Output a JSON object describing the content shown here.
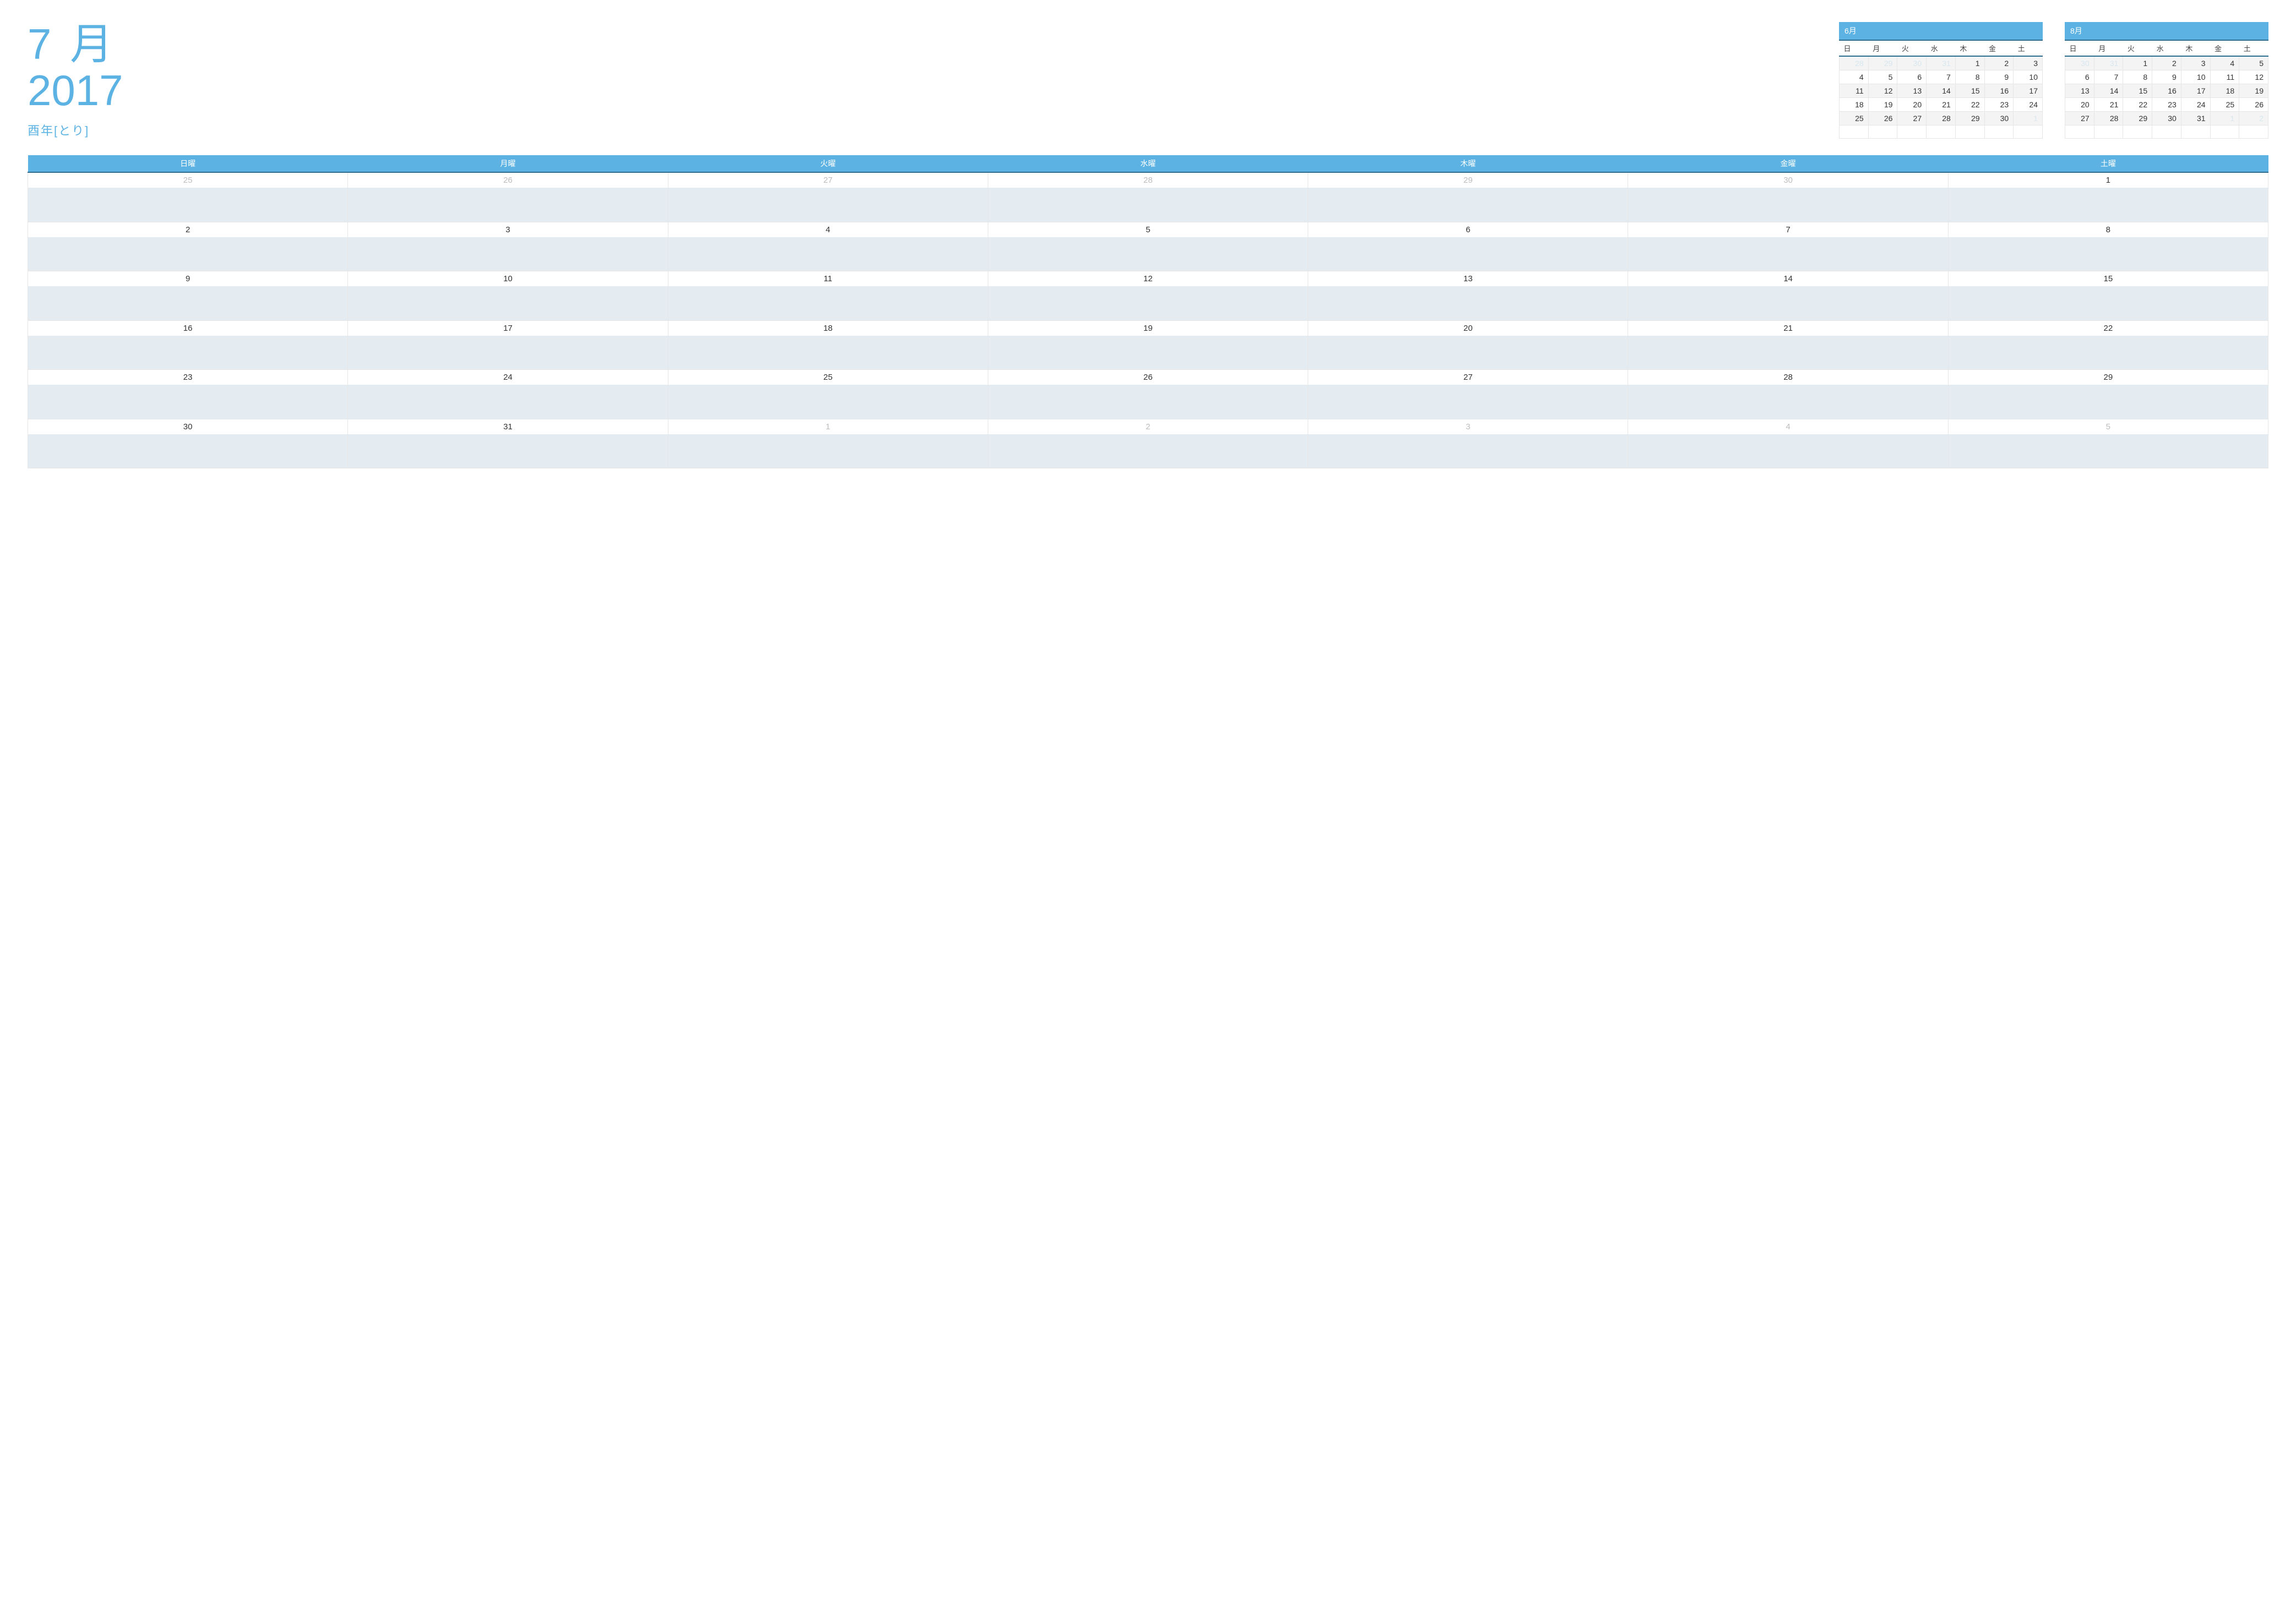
{
  "colors": {
    "accent": "#5cb3e3",
    "accent_dark": "#2f6d8f",
    "body_bg": "#e4ecf1"
  },
  "title": {
    "month": "7 月",
    "year": "2017",
    "sub": "酉年[とり]"
  },
  "mini_prev": {
    "label": "6月",
    "dow": [
      "日",
      "月",
      "火",
      "水",
      "木",
      "金",
      "土"
    ],
    "rows": [
      [
        {
          "v": "28",
          "dim": true
        },
        {
          "v": "29",
          "dim": true
        },
        {
          "v": "30",
          "dim": true
        },
        {
          "v": "31",
          "dim": true
        },
        {
          "v": "1"
        },
        {
          "v": "2"
        },
        {
          "v": "3"
        }
      ],
      [
        {
          "v": "4"
        },
        {
          "v": "5"
        },
        {
          "v": "6"
        },
        {
          "v": "7"
        },
        {
          "v": "8"
        },
        {
          "v": "9"
        },
        {
          "v": "10"
        }
      ],
      [
        {
          "v": "11"
        },
        {
          "v": "12"
        },
        {
          "v": "13"
        },
        {
          "v": "14"
        },
        {
          "v": "15"
        },
        {
          "v": "16"
        },
        {
          "v": "17"
        }
      ],
      [
        {
          "v": "18"
        },
        {
          "v": "19"
        },
        {
          "v": "20"
        },
        {
          "v": "21"
        },
        {
          "v": "22"
        },
        {
          "v": "23"
        },
        {
          "v": "24"
        }
      ],
      [
        {
          "v": "25"
        },
        {
          "v": "26"
        },
        {
          "v": "27"
        },
        {
          "v": "28"
        },
        {
          "v": "29"
        },
        {
          "v": "30"
        },
        {
          "v": "1",
          "dim": true
        }
      ],
      [
        {
          "v": ""
        },
        {
          "v": ""
        },
        {
          "v": ""
        },
        {
          "v": ""
        },
        {
          "v": ""
        },
        {
          "v": ""
        },
        {
          "v": ""
        }
      ]
    ]
  },
  "mini_next": {
    "label": "8月",
    "dow": [
      "日",
      "月",
      "火",
      "水",
      "木",
      "金",
      "土"
    ],
    "rows": [
      [
        {
          "v": "30",
          "dim": true
        },
        {
          "v": "31",
          "dim": true
        },
        {
          "v": "1"
        },
        {
          "v": "2"
        },
        {
          "v": "3"
        },
        {
          "v": "4"
        },
        {
          "v": "5"
        }
      ],
      [
        {
          "v": "6"
        },
        {
          "v": "7"
        },
        {
          "v": "8"
        },
        {
          "v": "9"
        },
        {
          "v": "10"
        },
        {
          "v": "11"
        },
        {
          "v": "12"
        }
      ],
      [
        {
          "v": "13"
        },
        {
          "v": "14"
        },
        {
          "v": "15"
        },
        {
          "v": "16"
        },
        {
          "v": "17"
        },
        {
          "v": "18"
        },
        {
          "v": "19"
        }
      ],
      [
        {
          "v": "20"
        },
        {
          "v": "21"
        },
        {
          "v": "22"
        },
        {
          "v": "23"
        },
        {
          "v": "24"
        },
        {
          "v": "25"
        },
        {
          "v": "26"
        }
      ],
      [
        {
          "v": "27"
        },
        {
          "v": "28"
        },
        {
          "v": "29"
        },
        {
          "v": "30"
        },
        {
          "v": "31"
        },
        {
          "v": "1",
          "dim": true
        },
        {
          "v": "2",
          "dim": true
        }
      ],
      [
        {
          "v": ""
        },
        {
          "v": ""
        },
        {
          "v": ""
        },
        {
          "v": ""
        },
        {
          "v": ""
        },
        {
          "v": ""
        },
        {
          "v": ""
        }
      ]
    ]
  },
  "big": {
    "dow": [
      "日曜",
      "月曜",
      "火曜",
      "水曜",
      "木曜",
      "金曜",
      "土曜"
    ],
    "weeks": [
      [
        {
          "v": "25",
          "dim": true
        },
        {
          "v": "26",
          "dim": true
        },
        {
          "v": "27",
          "dim": true
        },
        {
          "v": "28",
          "dim": true
        },
        {
          "v": "29",
          "dim": true
        },
        {
          "v": "30",
          "dim": true
        },
        {
          "v": "1"
        }
      ],
      [
        {
          "v": "2"
        },
        {
          "v": "3"
        },
        {
          "v": "4"
        },
        {
          "v": "5"
        },
        {
          "v": "6"
        },
        {
          "v": "7"
        },
        {
          "v": "8"
        }
      ],
      [
        {
          "v": "9"
        },
        {
          "v": "10"
        },
        {
          "v": "11"
        },
        {
          "v": "12"
        },
        {
          "v": "13"
        },
        {
          "v": "14"
        },
        {
          "v": "15"
        }
      ],
      [
        {
          "v": "16"
        },
        {
          "v": "17"
        },
        {
          "v": "18"
        },
        {
          "v": "19"
        },
        {
          "v": "20"
        },
        {
          "v": "21"
        },
        {
          "v": "22"
        }
      ],
      [
        {
          "v": "23"
        },
        {
          "v": "24"
        },
        {
          "v": "25"
        },
        {
          "v": "26"
        },
        {
          "v": "27"
        },
        {
          "v": "28"
        },
        {
          "v": "29"
        }
      ],
      [
        {
          "v": "30"
        },
        {
          "v": "31"
        },
        {
          "v": "1",
          "dim": true
        },
        {
          "v": "2",
          "dim": true
        },
        {
          "v": "3",
          "dim": true
        },
        {
          "v": "4",
          "dim": true
        },
        {
          "v": "5",
          "dim": true
        }
      ]
    ]
  }
}
